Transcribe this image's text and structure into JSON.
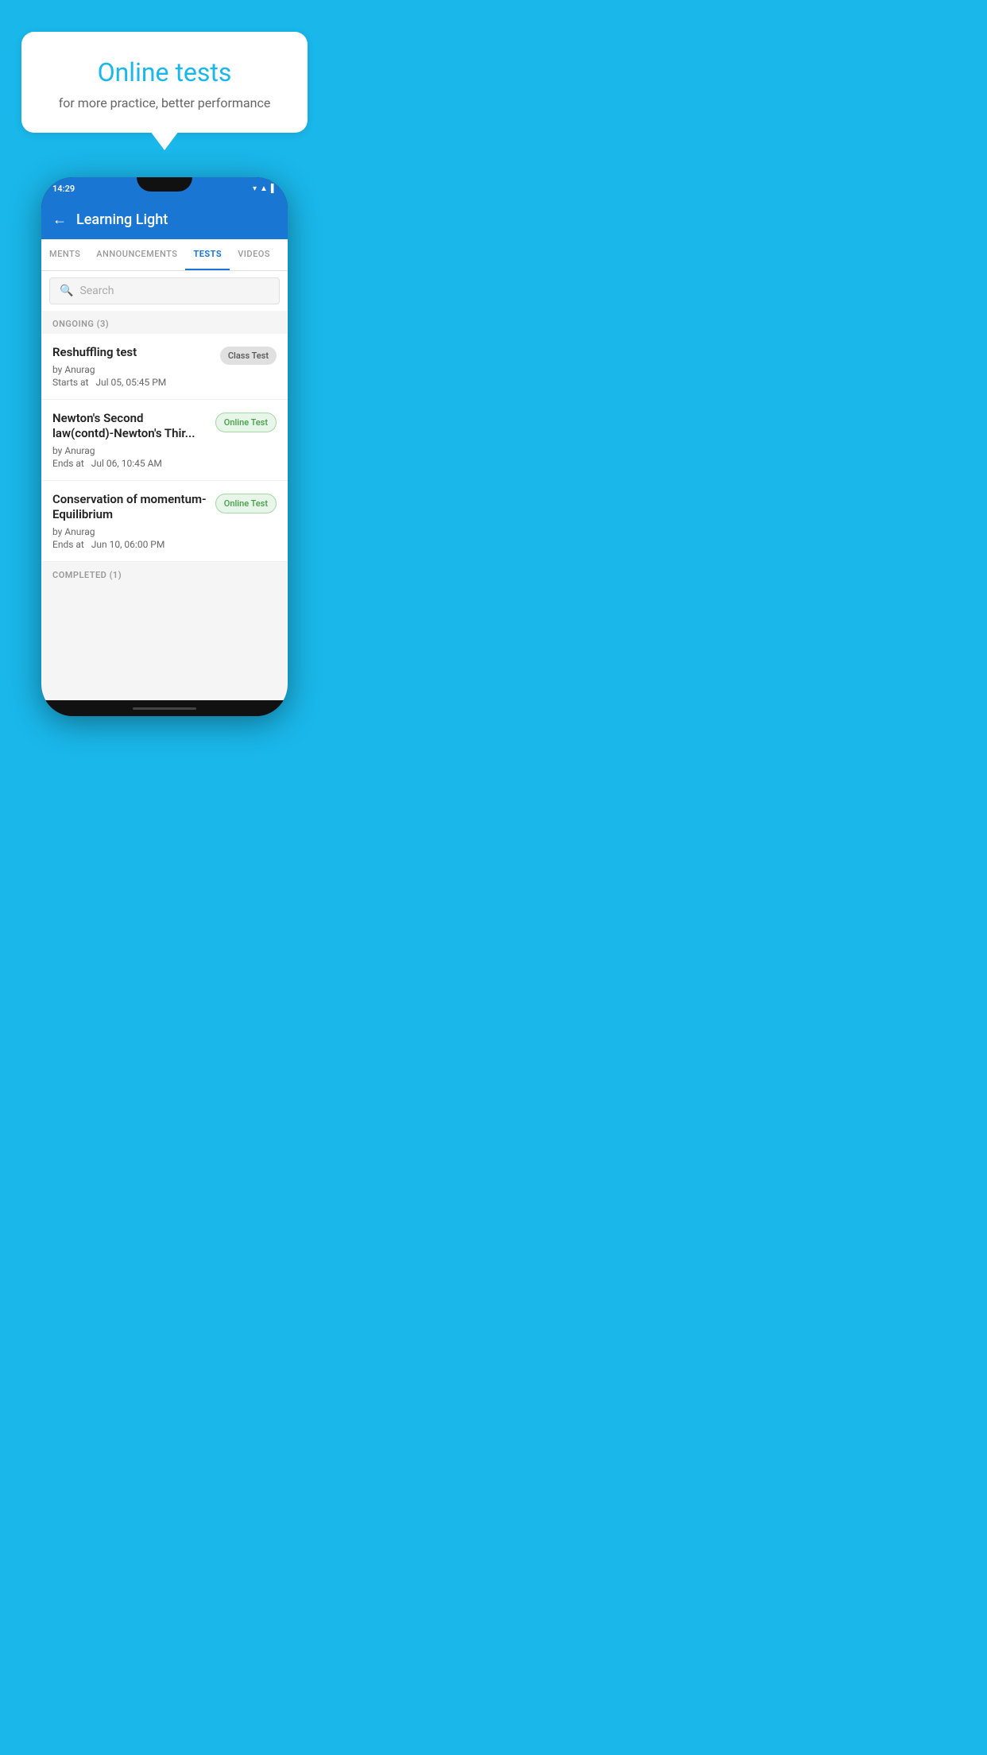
{
  "hero": {
    "title": "Online tests",
    "subtitle": "for more practice, better performance"
  },
  "phone": {
    "statusBar": {
      "time": "14:29",
      "icons": "▼◄█"
    },
    "header": {
      "title": "Learning Light",
      "backLabel": "←"
    },
    "tabs": [
      {
        "label": "MENTS",
        "active": false
      },
      {
        "label": "ANNOUNCEMENTS",
        "active": false
      },
      {
        "label": "TESTS",
        "active": true
      },
      {
        "label": "VIDEOS",
        "active": false
      }
    ],
    "search": {
      "placeholder": "Search",
      "icon": "🔍"
    },
    "ongoingSection": {
      "label": "ONGOING (3)"
    },
    "testItems": [
      {
        "name": "Reshuffling test",
        "by": "by Anurag",
        "date": "Starts at  Jul 05, 05:45 PM",
        "badge": "Class Test",
        "badgeType": "class"
      },
      {
        "name": "Newton's Second law(contd)-Newton's Thir...",
        "by": "by Anurag",
        "date": "Ends at  Jul 06, 10:45 AM",
        "badge": "Online Test",
        "badgeType": "online"
      },
      {
        "name": "Conservation of momentum-Equilibrium",
        "by": "by Anurag",
        "date": "Ends at  Jun 10, 06:00 PM",
        "badge": "Online Test",
        "badgeType": "online"
      }
    ],
    "completedSection": {
      "label": "COMPLETED (1)"
    }
  }
}
